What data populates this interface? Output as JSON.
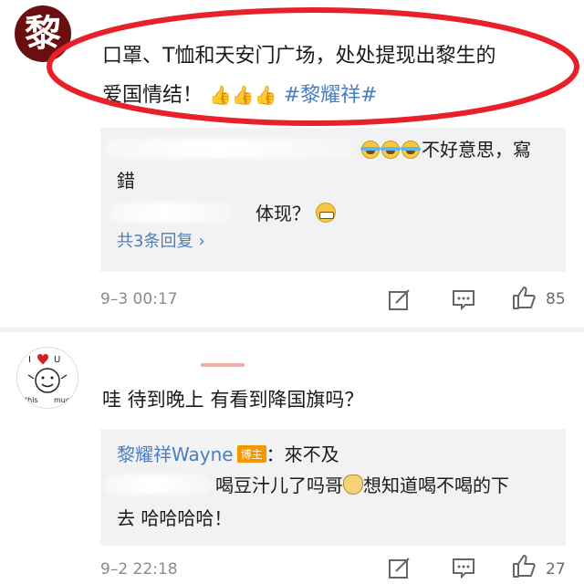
{
  "post": {
    "avatar_char": "黎",
    "line1": "口罩、T恤和天安门广场，处处提现出黎生的",
    "line2_text": "爱国情结！",
    "thumbs": "👍👍👍",
    "hashtag": "#黎耀祥#"
  },
  "comment1": {
    "reply_a_text": "不好意思，寫",
    "reply_a_text2": "錯",
    "reply_b_text": "体现？",
    "more_replies": "共3条回复",
    "chevron": "›",
    "timestamp": "9–3 00:17",
    "likes": "85"
  },
  "comment2": {
    "text": "哇  待到晚上  有看到降国旗吗？",
    "reply_author": "黎耀祥Wayne",
    "badge": "博主",
    "reply_text": "：來不及",
    "reply_b_text": "喝豆汁儿了吗哥",
    "reply_b_text2": "想知道喝不喝的下",
    "reply_b_line2": "去  哈哈哈哈！",
    "timestamp": "9–2 22:18",
    "likes": "27"
  },
  "colors": {
    "link": "#4a7ebf",
    "highlight_circle": "#e8202a",
    "badge": "#f39800",
    "box_bg": "#f2f2f2"
  }
}
